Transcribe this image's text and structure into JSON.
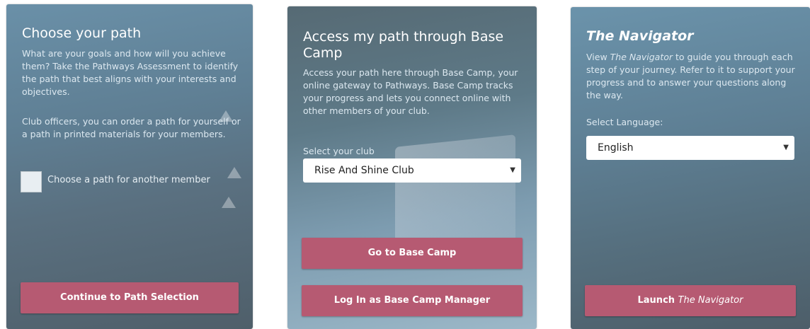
{
  "card_choose": {
    "title": "Choose your path",
    "description": "What are your goals and how will you achieve them? Take the Pathways Assessment to identify the path that best aligns with your interests and objectives.",
    "officers_note": "Club officers, you can order a path for yourself or a path in printed materials for your members.",
    "checkbox_label": "Choose a path for another member",
    "checkbox_checked": false,
    "button_label": "Continue to Path Selection"
  },
  "card_basecamp": {
    "title": "Access my path through Base Camp",
    "description": "Access your path here through Base Camp, your online gateway to Pathways. Base Camp tracks your progress and lets you connect online with other members of your club.",
    "select_label": "Select your club",
    "select_value": "Rise And Shine Club",
    "button_primary": "Go to Base Camp",
    "button_secondary": "Log In as Base Camp Manager"
  },
  "card_navigator": {
    "title": "The Navigator",
    "description_pre": "View ",
    "description_em": "The Navigator",
    "description_post": " to guide you through each step of your journey. Refer to it to support your progress and to answer your questions along the way.",
    "select_label": "Select Language:",
    "select_value": "English",
    "button_prefix": "Launch ",
    "button_em": "The Navigator"
  },
  "colors": {
    "button": "#b65a72",
    "card_blue": "#5f7f94",
    "select_bg": "#ffffff"
  },
  "icons": {
    "dropdown": "caret-down-icon"
  }
}
